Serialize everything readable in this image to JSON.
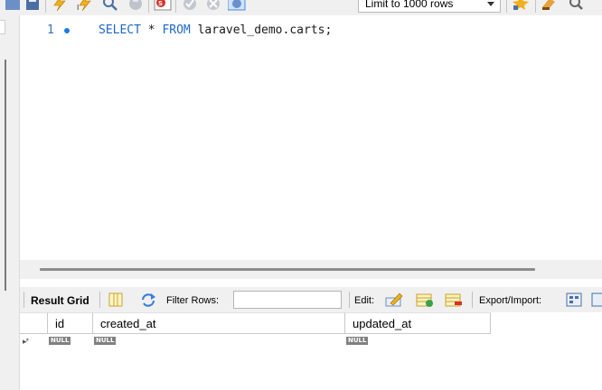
{
  "toolbar": {
    "icons": [
      "folder-icon",
      "save-icon",
      "execute-icon",
      "execute-current-icon",
      "explain-icon",
      "stop-icon",
      "toggle-error-icon",
      "commit-icon",
      "rollback-icon",
      "autocommit-icon",
      "beautify-icon",
      "find-icon"
    ],
    "limit_select": {
      "value": "Limit to 1000 rows"
    }
  },
  "editor": {
    "lines": [
      {
        "number": "1",
        "keyword1": "SELECT",
        "plain1": " * ",
        "keyword2": "FROM",
        "plain2": " laravel_demo.carts;"
      }
    ]
  },
  "result_toolbar": {
    "result_grid_label": "Result Grid",
    "filter_rows_label": "Filter Rows:",
    "filter_value": "",
    "edit_label": "Edit:",
    "export_import_label": "Export/Import:"
  },
  "grid": {
    "columns": [
      "id",
      "created_at",
      "updated_at"
    ],
    "new_row_marker": "▸*",
    "new_row": [
      "NULL",
      "NULL",
      "NULL"
    ]
  }
}
